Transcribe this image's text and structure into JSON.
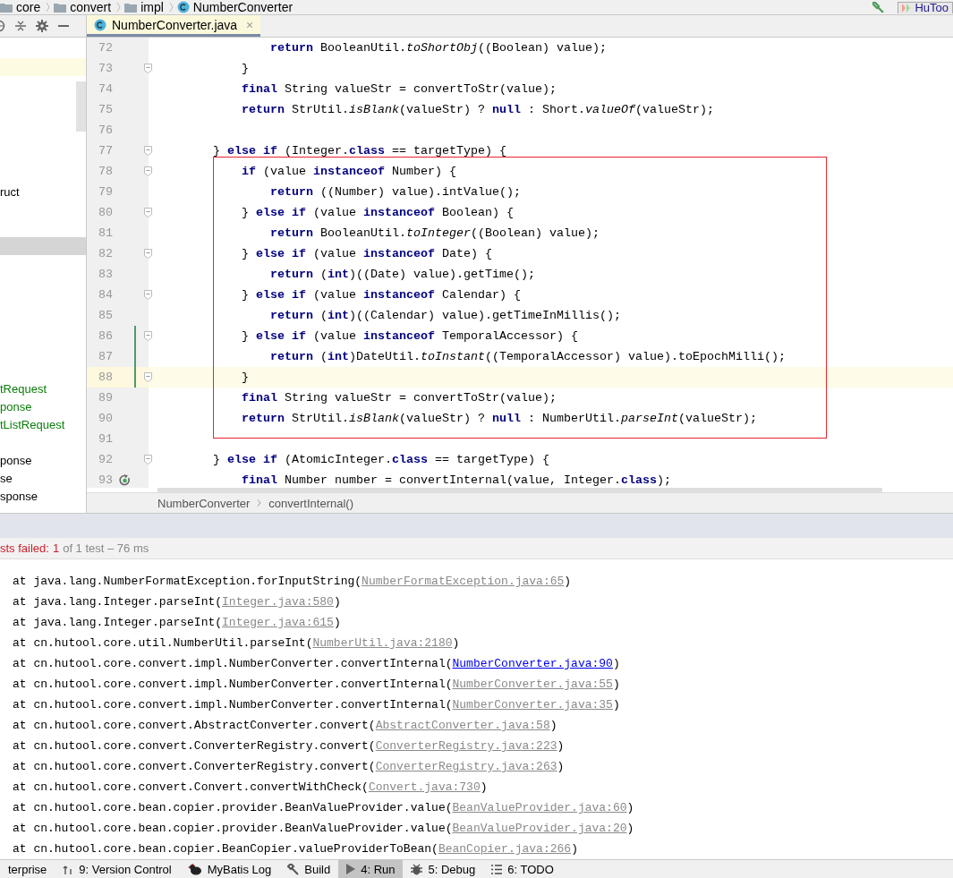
{
  "nav_bar": {
    "crumbs": [
      {
        "label": "core",
        "kind": "folder"
      },
      {
        "label": "convert",
        "kind": "folder"
      },
      {
        "label": "impl",
        "kind": "folder"
      },
      {
        "label": "NumberConverter",
        "kind": "class"
      }
    ],
    "run_config": "HuToo"
  },
  "editor_tabs": [
    {
      "label": "NumberConverter.java",
      "close": "×",
      "selected": true
    }
  ],
  "project_tree": [
    {
      "kind": "highlighted"
    },
    {
      "kind": "blank"
    },
    {
      "kind": "blank"
    },
    {
      "kind": "blank"
    },
    {
      "kind": "blank"
    },
    {
      "kind": "blank"
    },
    {
      "kind": "blank"
    },
    {
      "kind": "file",
      "label": "ruct",
      "color": "#000000"
    },
    {
      "kind": "blank"
    },
    {
      "kind": "blank"
    },
    {
      "kind": "selected"
    },
    {
      "kind": "blank"
    },
    {
      "kind": "blank"
    },
    {
      "kind": "blank"
    },
    {
      "kind": "blank"
    },
    {
      "kind": "blank"
    },
    {
      "kind": "blank"
    },
    {
      "kind": "blank"
    },
    {
      "kind": "file",
      "label": "tRequest",
      "color": "#0a7c0a"
    },
    {
      "kind": "file",
      "label": "ponse",
      "color": "#0a7c0a"
    },
    {
      "kind": "file",
      "label": "tListRequest",
      "color": "#0a7c0a"
    },
    {
      "kind": "blank"
    },
    {
      "kind": "file",
      "label": "ponse",
      "color": "#000000"
    },
    {
      "kind": "file",
      "label": "se",
      "color": "#000000"
    },
    {
      "kind": "file",
      "label": "sponse",
      "color": "#000000"
    }
  ],
  "editor": {
    "lines": [
      {
        "number": "72",
        "code": "                **return** BooleanUtil.*toShortObj*((Boolean) value);",
        "kind": "code",
        "fold": false,
        "changed": false,
        "current": false,
        "boxed": false
      },
      {
        "number": "73",
        "code": "            }",
        "kind": "code",
        "fold": true,
        "changed": false,
        "current": false,
        "boxed": false
      },
      {
        "number": "74",
        "code": "            **final** String valueStr = convertToStr(value);",
        "kind": "code",
        "fold": false,
        "changed": false,
        "current": false,
        "boxed": false
      },
      {
        "number": "75",
        "code": "            **return** StrUtil.*isBlank*(valueStr) ? **null** : Short.*valueOf*(valueStr);",
        "kind": "code",
        "fold": false,
        "changed": false,
        "current": false,
        "boxed": false
      },
      {
        "number": "76",
        "kind": "code",
        "fold": false,
        "changed": false,
        "current": false,
        "boxed": false
      },
      {
        "number": "77",
        "code": "        } **else if** (Integer.**class** == targetType) {",
        "kind": "code",
        "fold": true,
        "changed": false,
        "current": false,
        "boxed": false
      },
      {
        "number": "78",
        "code": "            **if** (value **instanceof** Number) {",
        "kind": "code",
        "fold": true,
        "changed": false,
        "current": false,
        "boxed": true
      },
      {
        "number": "79",
        "code": "                **return** ((Number) value).intValue();",
        "kind": "code",
        "fold": false,
        "changed": false,
        "current": false,
        "boxed": true
      },
      {
        "number": "80",
        "code": "            } **else if** (value **instanceof** Boolean) {",
        "kind": "code",
        "fold": true,
        "changed": false,
        "current": false,
        "boxed": true
      },
      {
        "number": "81",
        "code": "                **return** BooleanUtil.*toInteger*((Boolean) value);",
        "kind": "code",
        "fold": false,
        "changed": false,
        "current": false,
        "boxed": true
      },
      {
        "number": "82",
        "code": "            } **else if** (value **instanceof** Date) {",
        "kind": "code",
        "fold": true,
        "changed": false,
        "current": false,
        "boxed": true
      },
      {
        "number": "83",
        "code": "                **return** (**int**)((Date) value).getTime();",
        "kind": "code",
        "fold": false,
        "changed": false,
        "current": false,
        "boxed": true
      },
      {
        "number": "84",
        "code": "            } **else if** (value **instanceof** Calendar) {",
        "kind": "code",
        "fold": true,
        "changed": false,
        "current": false,
        "boxed": true
      },
      {
        "number": "85",
        "code": "                **return** (**int**)((Calendar) value).getTimeInMillis();",
        "kind": "code",
        "fold": false,
        "changed": false,
        "current": false,
        "boxed": true
      },
      {
        "number": "86",
        "code": "            } **else if** (value **instanceof** TemporalAccessor) {",
        "kind": "code",
        "fold": true,
        "changed": true,
        "current": false,
        "boxed": true
      },
      {
        "number": "87",
        "code": "                **return** (**int**)DateUtil.*toInstant*((TemporalAccessor) value).toEpochMilli();",
        "kind": "code",
        "fold": false,
        "changed": true,
        "current": false,
        "boxed": true
      },
      {
        "number": "88",
        "code": "            }",
        "kind": "code",
        "fold": true,
        "changed": true,
        "current": true,
        "boxed": true
      },
      {
        "number": "89",
        "code": "            **final** String valueStr = convertToStr(value);",
        "kind": "code",
        "fold": false,
        "changed": false,
        "current": false,
        "boxed": true
      },
      {
        "number": "90",
        "code": "            **return** StrUtil.*isBlank*(valueStr) ? **null** : NumberUtil.*parseInt*(valueStr);",
        "kind": "code",
        "fold": false,
        "changed": false,
        "current": false,
        "boxed": true
      },
      {
        "number": "91",
        "kind": "code",
        "fold": false,
        "changed": false,
        "current": false,
        "boxed": false
      },
      {
        "number": "92",
        "code": "        } **else if** (AtomicInteger.**class** == targetType) {",
        "kind": "code",
        "fold": true,
        "changed": false,
        "current": false,
        "boxed": false
      },
      {
        "number": "93",
        "code": "            **final** Number number = convertInternal(value, Integer.**class**);",
        "kind": "recursive-call",
        "fold": false,
        "changed": false,
        "current": false,
        "boxed": false
      }
    ]
  },
  "editor_breadcrumbs": [
    "NumberConverter",
    "convertInternal()"
  ],
  "run_panel": {
    "status": {
      "failed_label": "sts failed:",
      "failed_count": "1",
      "summary": "of 1 test – 76 ms"
    },
    "console": [
      {
        "text": "at java.lang.NumberFormatException.forInputString(",
        "link": "NumberFormatException.java:65",
        "end": ")",
        "active": false
      },
      {
        "text": "at java.lang.Integer.parseInt(",
        "link": "Integer.java:580",
        "end": ")",
        "active": false
      },
      {
        "text": "at java.lang.Integer.parseInt(",
        "link": "Integer.java:615",
        "end": ")",
        "active": false
      },
      {
        "text": "at cn.hutool.core.util.NumberUtil.parseInt(",
        "link": "NumberUtil.java:2180",
        "end": ")",
        "active": false
      },
      {
        "text": "at cn.hutool.core.convert.impl.NumberConverter.convertInternal(",
        "link": "NumberConverter.java:90",
        "end": ")",
        "active": true
      },
      {
        "text": "at cn.hutool.core.convert.impl.NumberConverter.convertInternal(",
        "link": "NumberConverter.java:55",
        "end": ")",
        "active": false
      },
      {
        "text": "at cn.hutool.core.convert.impl.NumberConverter.convertInternal(",
        "link": "NumberConverter.java:35",
        "end": ")",
        "active": false
      },
      {
        "text": "at cn.hutool.core.convert.AbstractConverter.convert(",
        "link": "AbstractConverter.java:58",
        "end": ")",
        "active": false
      },
      {
        "text": "at cn.hutool.core.convert.ConverterRegistry.convert(",
        "link": "ConverterRegistry.java:223",
        "end": ")",
        "active": false
      },
      {
        "text": "at cn.hutool.core.convert.ConverterRegistry.convert(",
        "link": "ConverterRegistry.java:263",
        "end": ")",
        "active": false
      },
      {
        "text": "at cn.hutool.core.convert.Convert.convertWithCheck(",
        "link": "Convert.java:730",
        "end": ")",
        "active": false
      },
      {
        "text": "at cn.hutool.core.bean.copier.provider.BeanValueProvider.value(",
        "link": "BeanValueProvider.java:60",
        "end": ")",
        "active": false
      },
      {
        "text": "at cn.hutool.core.bean.copier.provider.BeanValueProvider.value(",
        "link": "BeanValueProvider.java:20",
        "end": ")",
        "active": false
      },
      {
        "text": "at cn.hutool.core.bean.copier.BeanCopier.valueProviderToBean(",
        "link": "BeanCopier.java:266",
        "end": ")",
        "active": false
      }
    ]
  },
  "tool_strip": [
    {
      "label": "terprise",
      "kind": "plain",
      "selected": false
    },
    {
      "label": "9: Version Control",
      "kind": "vcs",
      "selected": false
    },
    {
      "label": "MyBatis Log",
      "kind": "mybatis",
      "selected": false
    },
    {
      "label": "Build",
      "kind": "build",
      "selected": false
    },
    {
      "label": "4: Run",
      "kind": "run",
      "selected": true
    },
    {
      "label": "5: Debug",
      "kind": "debug",
      "selected": false
    },
    {
      "label": "6: TODO",
      "kind": "todo",
      "selected": false
    }
  ]
}
